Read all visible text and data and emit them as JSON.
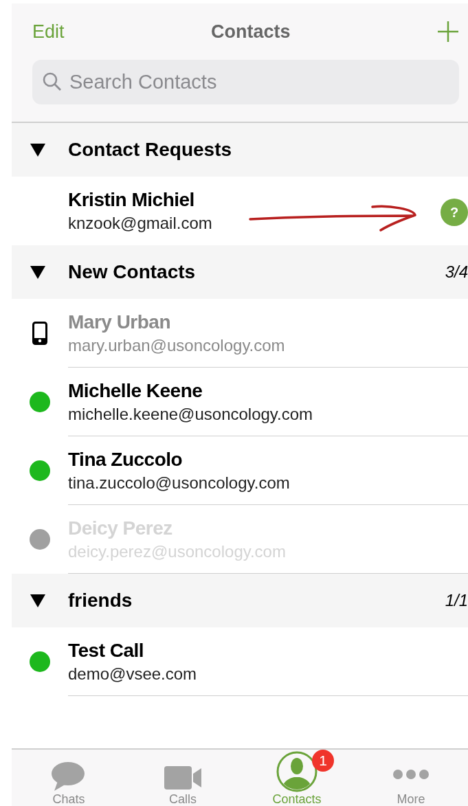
{
  "nav": {
    "left": "Edit",
    "title": "Contacts"
  },
  "search": {
    "placeholder": "Search Contacts"
  },
  "sections": [
    {
      "title": "Contact Requests",
      "expanded": true,
      "rows": [
        {
          "kind": "request",
          "name": "Kristin Michiel",
          "email": "knzook@gmail.com",
          "badge": "?"
        }
      ]
    },
    {
      "title": "New Contacts",
      "expanded": true,
      "count": "3/4",
      "rows": [
        {
          "kind": "mobile",
          "name": "Mary Urban",
          "email": "mary.urban@usoncology.com"
        },
        {
          "kind": "online",
          "color": "#1db81d",
          "name": "Michelle Keene",
          "email": "michelle.keene@usoncology.com"
        },
        {
          "kind": "online",
          "color": "#1db81d",
          "name": "Tina Zuccolo",
          "email": "tina.zuccolo@usoncology.com"
        },
        {
          "kind": "offline",
          "color": "#a0a0a0",
          "name": "Deicy Perez",
          "email": "deicy.perez@usoncology.com"
        }
      ]
    },
    {
      "title": "friends",
      "expanded": true,
      "count": "1/1",
      "rows": [
        {
          "kind": "online",
          "color": "#1db81d",
          "name": "Test Call",
          "email": "demo@vsee.com"
        }
      ]
    }
  ],
  "tabs": [
    {
      "kind": "chats",
      "label": "Chats",
      "selected": false
    },
    {
      "kind": "calls",
      "label": "Calls",
      "selected": false
    },
    {
      "kind": "contacts",
      "label": "Contacts",
      "selected": true,
      "badge": "1"
    },
    {
      "kind": "more",
      "label": "More",
      "selected": false
    }
  ]
}
